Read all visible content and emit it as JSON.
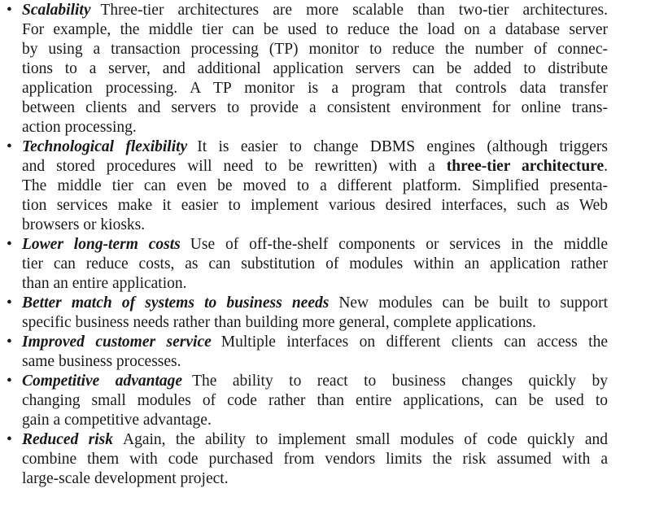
{
  "items": [
    {
      "term": "Scalability",
      "lines": [
        "Three-tier architectures are more scalable than two-tier architectures.",
        "For example, the middle tier can be used to reduce the load on a database server",
        "by using a transaction processing (TP) monitor to reduce the number of connec-",
        "tions to a server, and additional application servers can be added to distribute",
        "application processing. A TP monitor is a program that controls data transfer",
        "between clients and servers to provide a consistent environment for online trans-",
        "action processing."
      ]
    },
    {
      "term": "Technological flexibility",
      "lines": [
        "It is easier to change DBMS engines (although triggers",
        "and stored procedures will need to be rewritten) with a ",
        "three-tier architecture",
        ".",
        "The middle tier can even be moved to a different platform. Simplified presenta-",
        "tion services make it easier to implement various desired interfaces, such as Web",
        "browsers or kiosks."
      ]
    },
    {
      "term": "Lower long-term costs",
      "lines": [
        "Use of off-the-shelf components or services in the middle",
        "tier can reduce costs, as can substitution of modules within an application rather",
        "than an entire application."
      ]
    },
    {
      "term": "Better match of systems to business needs",
      "lines": [
        "New modules can be built to support",
        "specific business needs rather than building more general, complete applications."
      ]
    },
    {
      "term": "Improved customer service",
      "lines": [
        "Multiple interfaces on different clients can access the",
        "same business processes."
      ]
    },
    {
      "term": "Competitive advantage",
      "lines": [
        "The ability to react to business changes quickly by",
        "changing small modules of code rather than entire applications, can be used to",
        "gain a competitive advantage."
      ]
    },
    {
      "term": "Reduced risk",
      "lines": [
        "Again, the ability to implement small modules of code quickly and",
        "combine them with code purchased from vendors limits the risk assumed with a",
        "large-scale development project."
      ]
    }
  ]
}
